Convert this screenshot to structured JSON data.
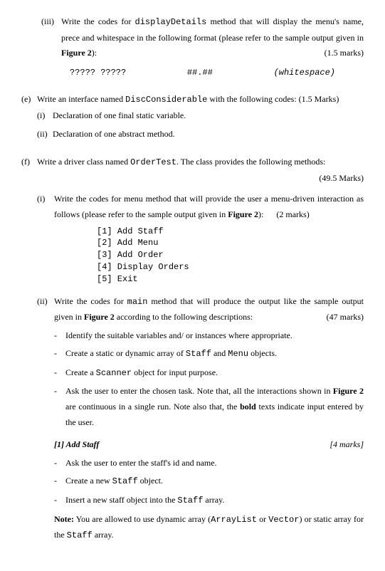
{
  "items": {
    "iii": {
      "marker": "(iii)",
      "text_1": "Write the codes for ",
      "code_1": "displayDetails",
      "text_2": " method that will display the menu's name, prece and whitespace in the following format (please refer to the sample output given in ",
      "bold_1": "Figure 2",
      "text_3": "):",
      "marks": "(1.5 marks)",
      "format": {
        "col1": "????? ?????",
        "col2": "##.##",
        "col3": "(whitespace)"
      }
    },
    "e": {
      "marker": "(e)",
      "text_1": "Write an interface named ",
      "code_1": "DiscConsiderable",
      "text_2": " with the following codes:  (1.5 Marks)",
      "sub_i": {
        "marker": "(i)",
        "text": "Declaration of one final static variable."
      },
      "sub_ii": {
        "marker": "(ii)",
        "text": "Declaration of one abstract method."
      }
    },
    "f": {
      "marker": "(f)",
      "text_1": "Write a driver class named ",
      "code_1": "OrderTest",
      "text_2": ". The class provides the following methods:",
      "marks": "(49.5 Marks)",
      "sub_i": {
        "marker": "(i)",
        "text_1": "Write the codes for menu method that will provide the user a menu-driven interaction as follows (please refer to the sample output given in ",
        "bold_1": "Figure 2",
        "text_2": "):",
        "marks": "(2 marks)",
        "menu": {
          "l1": "[1] Add Staff",
          "l2": "[2] Add Menu",
          "l3": "[3] Add Order",
          "l4": "[4] Display Orders",
          "l5": "[5] Exit"
        }
      },
      "sub_ii": {
        "marker": "(ii)",
        "text_1": "Write the codes for ",
        "code_1": "main",
        "text_2": " method that will produce the output like the sample output given in ",
        "bold_1": "Figure 2",
        "text_3": " according to the following descriptions:",
        "marks": "(47 marks)",
        "dashes": {
          "d1": "Identify the suitable variables and/ or instances where appropriate.",
          "d2_a": "Create a static or dynamic array of ",
          "d2_code1": "Staff",
          "d2_b": " and ",
          "d2_code2": "Menu",
          "d2_c": " objects.",
          "d3_a": "Create a ",
          "d3_code1": "Scanner",
          "d3_b": " object for input purpose.",
          "d4_a": "Ask the user to enter the chosen task. Note that, all the interactions shown in ",
          "d4_bold": "Figure 2",
          "d4_b": " are continuous in a single run. Note also that, the ",
          "d4_bold2": "bold",
          "d4_c": " texts indicate input entered by the user."
        },
        "add_staff": {
          "title": "[1] Add Staff",
          "marks": "[4 marks]",
          "d1": "Ask the user to enter the staff's id and name.",
          "d2_a": "Create a new ",
          "d2_code": "Staff",
          "d2_b": " object.",
          "d3_a": "Insert a new staff object into the ",
          "d3_code": "Staff",
          "d3_b": " array.",
          "note_label": "Note:",
          "note_1": " You are allowed to use dynamic array (",
          "note_code1": "ArrayList",
          "note_2": " or ",
          "note_code2": "Vector",
          "note_3": ") or static array for the ",
          "note_code3": "Staff",
          "note_4": " array."
        }
      }
    }
  }
}
